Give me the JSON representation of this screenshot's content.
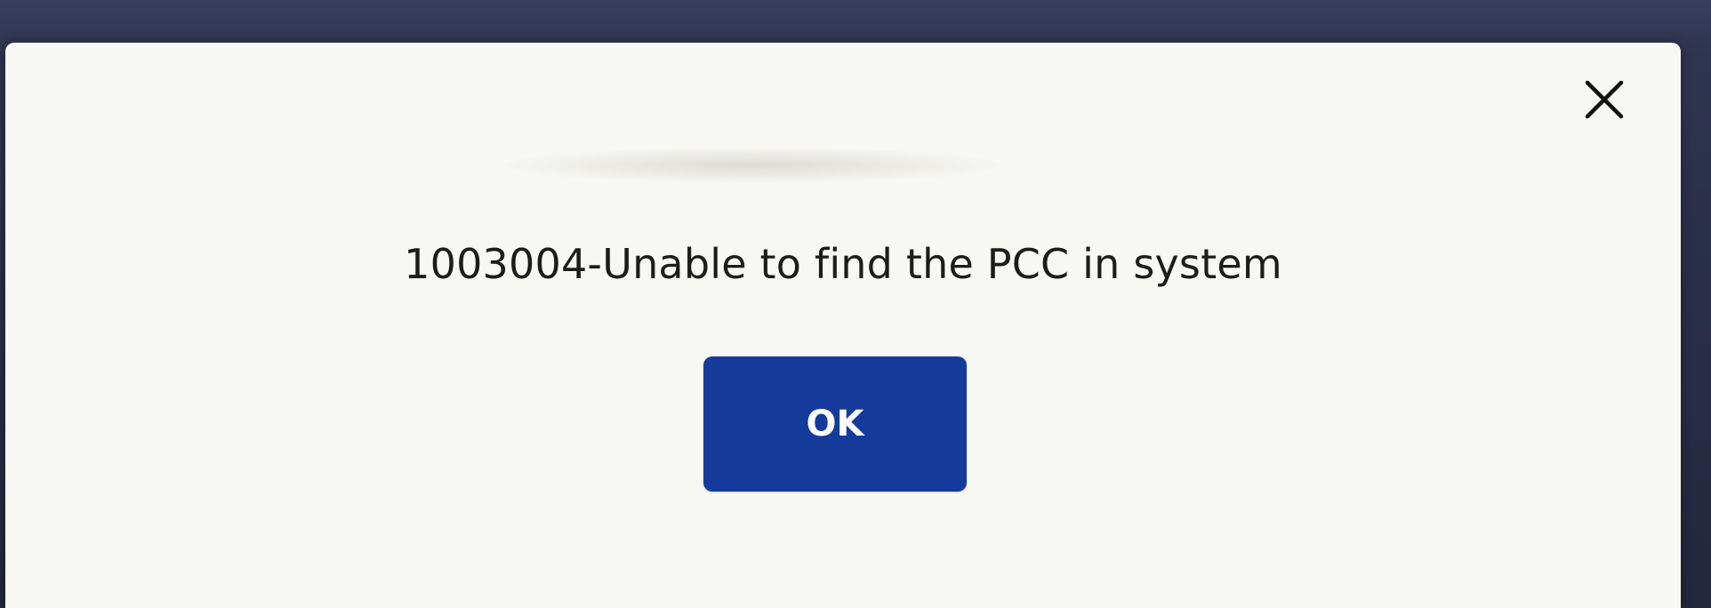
{
  "dialog": {
    "message": "1003004-Unable to find the PCC in system",
    "ok_label": "OK",
    "close_icon": "close-icon"
  },
  "colors": {
    "dialog_background": "#f7f8f4",
    "ok_button": "#143a9c",
    "ok_text": "#ffffff",
    "message_text": "#1c1c1c"
  }
}
